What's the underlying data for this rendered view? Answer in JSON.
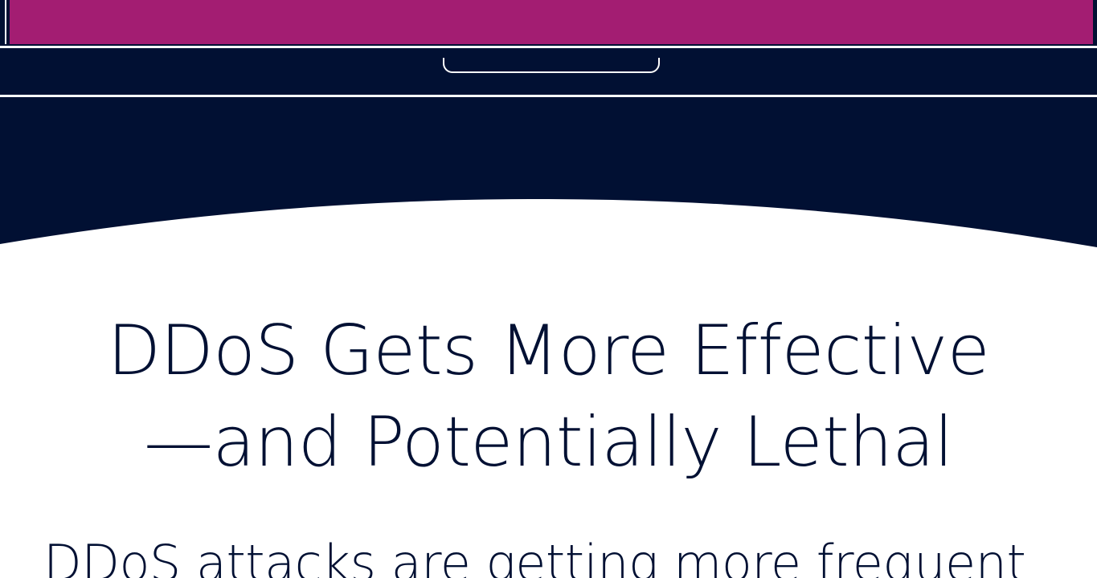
{
  "colors": {
    "navy": "#011033",
    "magenta": "#a31d72",
    "white": "#ffffff"
  },
  "article": {
    "title_line1": "DDoS Gets More Effective",
    "title_line2": "—and Potentially Lethal",
    "intro_partial": "DDoS attacks are getting more frequent"
  }
}
